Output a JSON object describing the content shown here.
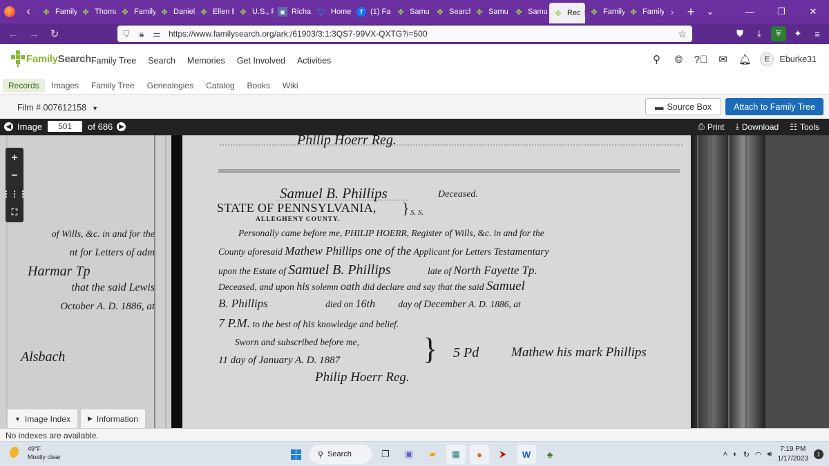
{
  "browser": {
    "tabs": [
      {
        "label": "Family",
        "icon": "familysearch-tree-icon"
      },
      {
        "label": "Thoma",
        "icon": "familysearch-tree-icon"
      },
      {
        "label": "Family",
        "icon": "familysearch-tree-icon"
      },
      {
        "label": "Daniel",
        "icon": "familysearch-tree-icon"
      },
      {
        "label": "Ellen E",
        "icon": "familysearch-tree-icon"
      },
      {
        "label": "U.S., F",
        "icon": "familysearch-tree-icon"
      },
      {
        "label": "Richa",
        "icon": "image-icon"
      },
      {
        "label": "Home",
        "icon": "twitter-icon"
      },
      {
        "label": "(1) Fa",
        "icon": "facebook-icon"
      },
      {
        "label": "Samu",
        "icon": "familysearch-tree-icon"
      },
      {
        "label": "Search",
        "icon": "familysearch-tree-icon"
      },
      {
        "label": "Samu",
        "icon": "familysearch-tree-icon"
      },
      {
        "label": "Samu",
        "icon": "familysearch-tree-icon"
      },
      {
        "label": "Rec",
        "icon": "familysearch-tree-icon",
        "active": true
      },
      {
        "label": "Family",
        "icon": "familysearch-tree-icon"
      },
      {
        "label": "Family",
        "icon": "familysearch-tree-icon"
      }
    ],
    "url": "https://www.familysearch.org/ark:/61903/3:1:3QS7-99VX-QXTG?i=500"
  },
  "header": {
    "logo_text_family": "Family",
    "logo_text_search": "Search",
    "menu": [
      "Family Tree",
      "Search",
      "Memories",
      "Get Involved",
      "Activities"
    ],
    "avatar_initial": "E",
    "username": "Eburke31"
  },
  "subnav": {
    "items": [
      "Records",
      "Images",
      "Family Tree",
      "Genealogies",
      "Catalog",
      "Books",
      "Wiki"
    ],
    "active": "Records"
  },
  "filmbar": {
    "film_label": "Film # 007612158",
    "source_box_label": "Source Box",
    "attach_label": "Attach to Family Tree"
  },
  "image_toolbar": {
    "image_label": "Image",
    "image_number": "501",
    "of_label": "of 686",
    "print_label": "Print",
    "download_label": "Download",
    "tools_label": "Tools"
  },
  "document": {
    "deceased_name": "Samuel B. Phillips",
    "deceased_label": "Deceased.",
    "state_line": "STATE OF PENNSYLVANIA,",
    "ss": "S. S.",
    "county_line": "ALLEGHENY COUNTY.",
    "line1": "Personally came before me, PHILIP HOERR, Register of Wills, &c. in and for the",
    "line2_a": "County aforesaid",
    "line2_hand": "Mathew Phillips one of the",
    "line2_b": "Applicant for Letters",
    "line2_hand2": "Testamentary",
    "line3_a": "upon the Estate of",
    "line3_hand": "Samuel B. Phillips",
    "line3_b": "late of",
    "line3_hand2": "North Fayette Tp.",
    "line4_a": "Deceased, and upon",
    "line4_hand": "his",
    "line4_b": "solemn",
    "line4_hand2": "oath",
    "line4_c": "did declare and say that the said",
    "line4_hand3": "Samuel",
    "line5_hand": "B. Phillips",
    "line5_a": "died on",
    "line5_hand2": "16th",
    "line5_b": "day of",
    "line5_hand3": "December",
    "line5_c": "A. D. 1886, at",
    "line6_hand": "7 P.M.",
    "line6_a": "to the best of",
    "line6_hand2": "his",
    "line6_b": "knowledge and belief.",
    "sworn": "Sworn and subscribed before me,",
    "sworn_day": "11 day of January A. D. 1887",
    "signature_clerk": "Philip Hoerr Reg.",
    "signature_applicant": "Mathew his mark Phillips",
    "fee": "5 Pd",
    "top_signature": "Philip Hoerr Reg.",
    "left_page_lines": [
      "of Wills, &c. in and for the",
      "nt for Letters of adm",
      "Harmar Tp",
      "that the said Lewis",
      "October A. D. 1886, at",
      "Alsbach"
    ]
  },
  "panel": {
    "image_index_label": "Image Index",
    "information_label": "Information",
    "no_index_text": "No indexes are available."
  },
  "taskbar": {
    "temperature": "49°F",
    "weather": "Mostly clear",
    "search_label": "Search",
    "time": "7:19 PM",
    "date": "1/17/2023",
    "notification_count": "1"
  }
}
